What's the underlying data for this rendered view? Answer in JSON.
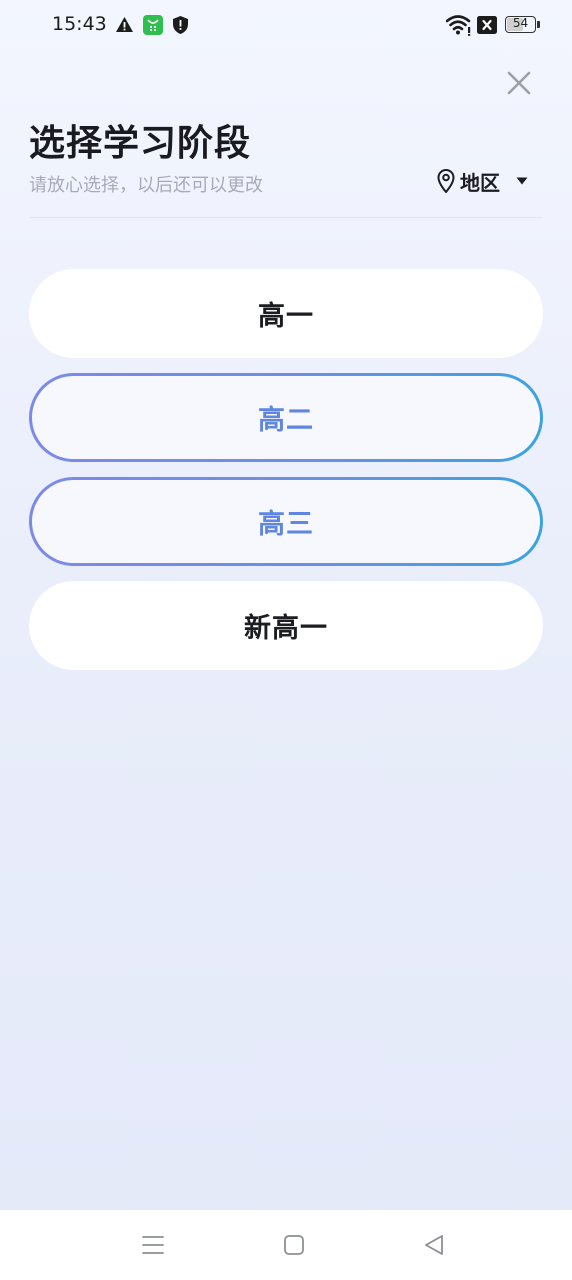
{
  "status_bar": {
    "time": "15:43",
    "battery_level": "54",
    "icons": [
      "warning-icon",
      "app-badge-icon",
      "shield-icon",
      "wifi-icon",
      "sim-disabled-icon",
      "battery-icon"
    ]
  },
  "header": {
    "title": "选择学习阶段",
    "subtitle": "请放心选择，以后还可以更改",
    "region_label": "地区",
    "close_icon": "close-icon",
    "region_icon": "location-pin-icon",
    "dropdown_icon": "caret-down-icon"
  },
  "grades": [
    {
      "label": "高一",
      "selected": false
    },
    {
      "label": "高二",
      "selected": true
    },
    {
      "label": "高三",
      "selected": true
    },
    {
      "label": "新高一",
      "selected": false
    }
  ],
  "nav_bar": {
    "icons": [
      "menu-icon",
      "home-icon",
      "back-icon"
    ]
  },
  "colors": {
    "selected_text": "#5f86e2",
    "selected_border_start": "#7d89e8",
    "selected_border_end": "#3ca3e0",
    "subtitle": "#a7abb6"
  }
}
